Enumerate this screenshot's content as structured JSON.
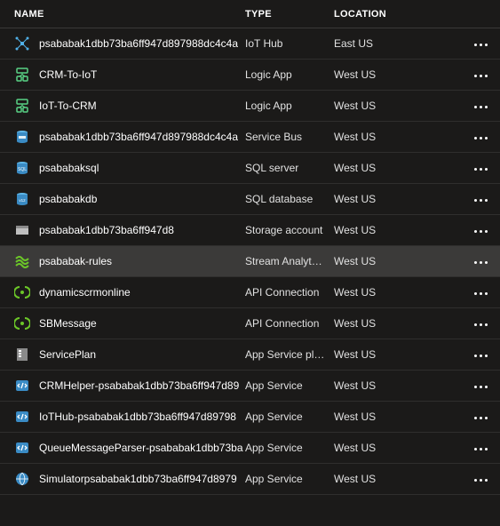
{
  "columns": {
    "name": "NAME",
    "type": "TYPE",
    "location": "LOCATION"
  },
  "rows": [
    {
      "icon": "iothub",
      "name": "psababak1dbb73ba6ff947d897988dc4c4a",
      "type": "IoT Hub",
      "location": "East US",
      "selected": false
    },
    {
      "icon": "logicapp",
      "name": "CRM-To-IoT",
      "type": "Logic App",
      "location": "West US",
      "selected": false
    },
    {
      "icon": "logicapp",
      "name": "IoT-To-CRM",
      "type": "Logic App",
      "location": "West US",
      "selected": false
    },
    {
      "icon": "servicebus",
      "name": "psababak1dbb73ba6ff947d897988dc4c4a",
      "type": "Service Bus",
      "location": "West US",
      "selected": false
    },
    {
      "icon": "sqlserver",
      "name": "psababaksql",
      "type": "SQL server",
      "location": "West US",
      "selected": false
    },
    {
      "icon": "sqldb",
      "name": "psababakdb",
      "type": "SQL database",
      "location": "West US",
      "selected": false
    },
    {
      "icon": "storage",
      "name": "psababak1dbb73ba6ff947d8",
      "type": "Storage account",
      "location": "West US",
      "selected": false
    },
    {
      "icon": "stream",
      "name": "psababak-rules",
      "type": "Stream Analyt…",
      "location": "West US",
      "selected": true
    },
    {
      "icon": "apiconn",
      "name": "dynamicscrmonline",
      "type": "API Connection",
      "location": "West US",
      "selected": false
    },
    {
      "icon": "apiconn",
      "name": "SBMessage",
      "type": "API Connection",
      "location": "West US",
      "selected": false
    },
    {
      "icon": "appplan",
      "name": "ServicePlan",
      "type": "App Service pl…",
      "location": "West US",
      "selected": false
    },
    {
      "icon": "appsvc",
      "name": "CRMHelper-psababak1dbb73ba6ff947d89",
      "type": "App Service",
      "location": "West US",
      "selected": false
    },
    {
      "icon": "appsvc",
      "name": "IoTHub-psababak1dbb73ba6ff947d89798",
      "type": "App Service",
      "location": "West US",
      "selected": false
    },
    {
      "icon": "appsvc",
      "name": "QueueMessageParser-psababak1dbb73ba",
      "type": "App Service",
      "location": "West US",
      "selected": false
    },
    {
      "icon": "globe",
      "name": "Simulatorpsababak1dbb73ba6ff947d8979",
      "type": "App Service",
      "location": "West US",
      "selected": false
    }
  ]
}
